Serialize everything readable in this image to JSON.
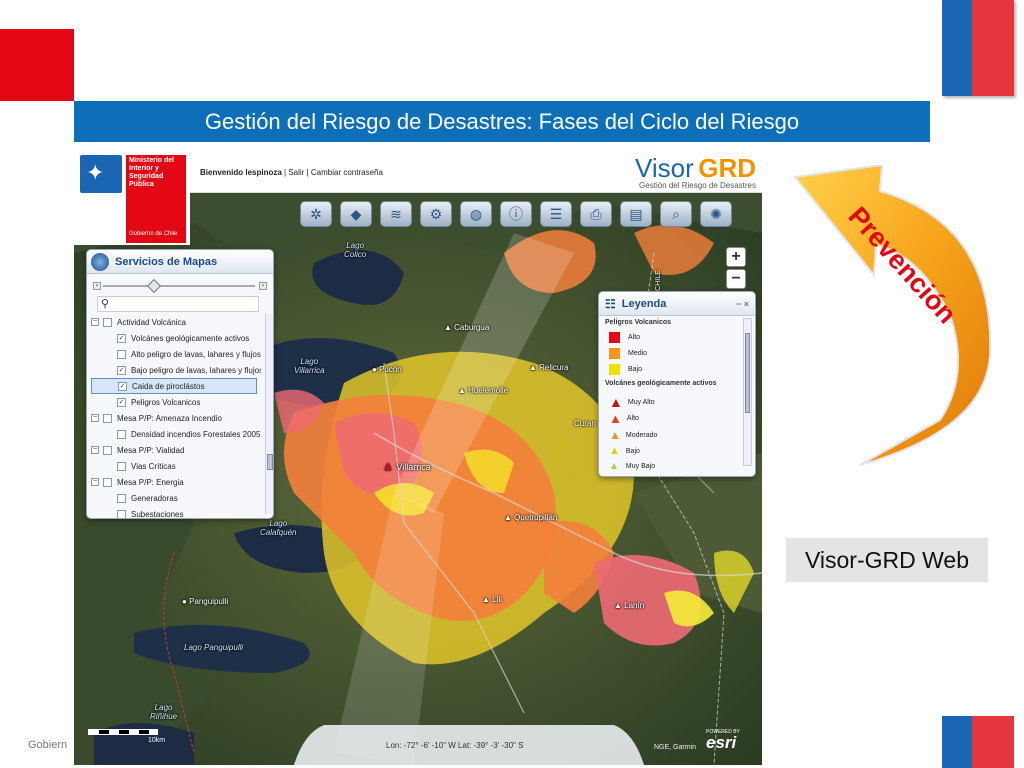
{
  "slide": {
    "title": "Gestión del Riesgo de Desastres: Fases del Ciclo del Riesgo",
    "prevencion": "Prevención",
    "visor_web_label": "Visor-GRD Web",
    "footer_left": "Gobiern",
    "colors": {
      "red": "#e30613",
      "blue": "#0d6fb8",
      "orange": "#f7a21b"
    }
  },
  "app": {
    "ministry_lines": [
      "Ministerio del",
      "Interior y",
      "Seguridad",
      "Pública"
    ],
    "gobierno": "Gobierno de Chile",
    "welcome": "Bienvenido lespinoza",
    "salir": "Salir",
    "cambiar": "Cambiar contraseña",
    "separator": "|",
    "logo_visor": "Visor",
    "logo_grd": "GRD",
    "logo_sub": "Gestión del Riesgo de Desastres"
  },
  "toolbar_icons": [
    "asterisk-icon",
    "alert-icon",
    "rss-icon",
    "gear-icon",
    "globe-icon",
    "info-icon",
    "list-icon",
    "print-icon",
    "book-icon",
    "search-map-icon",
    "network-icon"
  ],
  "servicios": {
    "title": "Servicios de Mapas",
    "items": [
      {
        "label": "Actividad Volcánica",
        "level": 0,
        "checked": false,
        "expander": "−"
      },
      {
        "label": "Volcánes geológicamente activos",
        "level": 1,
        "checked": true
      },
      {
        "label": "Alto peligro de lavas, lahares y flujos",
        "level": 1,
        "checked": false
      },
      {
        "label": "Bajo peligro de lavas, lahares y flujos",
        "level": 1,
        "checked": true
      },
      {
        "label": "Caida de piroclástos",
        "level": 1,
        "checked": true,
        "selected": true
      },
      {
        "label": "Peligros Volcanicos",
        "level": 1,
        "checked": true
      },
      {
        "label": "Mesa P/P: Amenaza Incendio",
        "level": 0,
        "checked": false,
        "expander": "−"
      },
      {
        "label": "Densidad incendios Forestales 2005",
        "level": 1,
        "checked": false
      },
      {
        "label": "Mesa P/P: Vialidad",
        "level": 0,
        "checked": false,
        "expander": "−"
      },
      {
        "label": "Vias Críticas",
        "level": 1,
        "checked": false
      },
      {
        "label": "Mesa P/P: Energia",
        "level": 0,
        "checked": false,
        "expander": "−"
      },
      {
        "label": "Generadoras",
        "level": 1,
        "checked": false
      },
      {
        "label": "Subestaciones",
        "level": 1,
        "checked": false
      }
    ]
  },
  "leyenda": {
    "title": "Leyenda",
    "controls": "− ×",
    "group1": "Peligros Volcanicos",
    "items1": [
      {
        "label": "Alto",
        "color": "#e30613"
      },
      {
        "label": "Medio",
        "color": "#f7941d"
      },
      {
        "label": "Bajo",
        "color": "#f2e000"
      }
    ],
    "group2": "Volcánes geológicamente activos",
    "items2": [
      {
        "label": "Muy Alto",
        "color": "#c0151b"
      },
      {
        "label": "Alto",
        "color": "#e0411f"
      },
      {
        "label": "Moderado",
        "color": "#f7941d"
      },
      {
        "label": "Bajo",
        "color": "#f2e000"
      },
      {
        "label": "Muy Bajo",
        "color": "#9bd94b"
      }
    ]
  },
  "map": {
    "zoom_in": "+",
    "zoom_out": "−",
    "labels": {
      "lago_colico": "Lago\nColico",
      "caburgua": "Caburgua",
      "lago_villarrica": "Lago\nVillarrica",
      "pucon": "Pucón",
      "huelemolle": "Huelemolle",
      "relicura": "Relicura",
      "curarrehue": "Curarr",
      "villarrica": "Villarrica",
      "quetrupillan": "Quetrupillán",
      "lago_calafquen": "Lago\nCalafquén",
      "panguipulli": "Panguipulli",
      "lago_panguipulli": "Lago Panguipulli",
      "lago_rinihue": "Lago\nRiñihue",
      "lili": "Lili",
      "lanin": "Lanín",
      "chile_border": "CHILE"
    },
    "coords": "Lon: -72° -6' -10\" W   Lat: -39° -3' -30\" S",
    "scale": "10km",
    "attribution": "NGE, Garmin",
    "powered_by": "POWERED BY",
    "esri": "esri"
  }
}
